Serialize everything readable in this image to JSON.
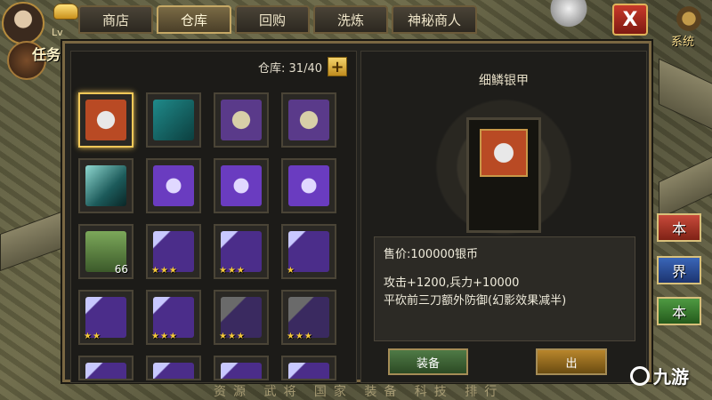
{
  "tabs": [
    {
      "label": "商店",
      "active": false
    },
    {
      "label": "仓库",
      "active": true
    },
    {
      "label": "回购",
      "active": false
    },
    {
      "label": "洗炼",
      "active": false
    },
    {
      "label": "神秘商人",
      "active": false
    }
  ],
  "top": {
    "level_label": "Lv",
    "task_label": "任务",
    "close_glyph": "X",
    "system_label": "系统"
  },
  "side_buttons": [
    "本",
    "界",
    "本"
  ],
  "bottom_strip": "资源 武将 国家 装备 科技 排行",
  "watermark": "九游",
  "warehouse": {
    "capacity_label": "仓库: 31/40",
    "expand_glyph": "+"
  },
  "items": [
    {
      "icon": "armor-red",
      "selected": true
    },
    {
      "icon": "scroll-teal"
    },
    {
      "icon": "ore-purple"
    },
    {
      "icon": "ore-purple"
    },
    {
      "icon": "sword-teal"
    },
    {
      "icon": "scroll-purple"
    },
    {
      "icon": "scroll-purple"
    },
    {
      "icon": "scroll-purple"
    },
    {
      "icon": "slabs-green",
      "qty": "66"
    },
    {
      "icon": "axe-purple",
      "stars": "★★★"
    },
    {
      "icon": "axe-purple",
      "stars": "★★★"
    },
    {
      "icon": "axe-purple",
      "stars": "★"
    },
    {
      "icon": "axe-purple",
      "stars": "★★"
    },
    {
      "icon": "axe-purple",
      "stars": "★★★"
    },
    {
      "icon": "horse-purple",
      "stars": "★★★"
    },
    {
      "icon": "horse-purple",
      "stars": "★★★"
    },
    {
      "icon": "axe-purple"
    },
    {
      "icon": "axe-purple"
    },
    {
      "icon": "axe-purple"
    },
    {
      "icon": "axe-purple"
    }
  ],
  "detail": {
    "name": "细鳞银甲",
    "price": "售价:100000银币",
    "stats": "攻击+1200,兵力+10000",
    "effect": "平砍前三刀额外防御(幻影效果减半)",
    "equip_label": "装备",
    "sell_label": "出"
  },
  "colors": {
    "frame": "#7a6742",
    "star": "#f4c93a",
    "close_red": "#c73a2a",
    "selected": "#f2c858"
  }
}
